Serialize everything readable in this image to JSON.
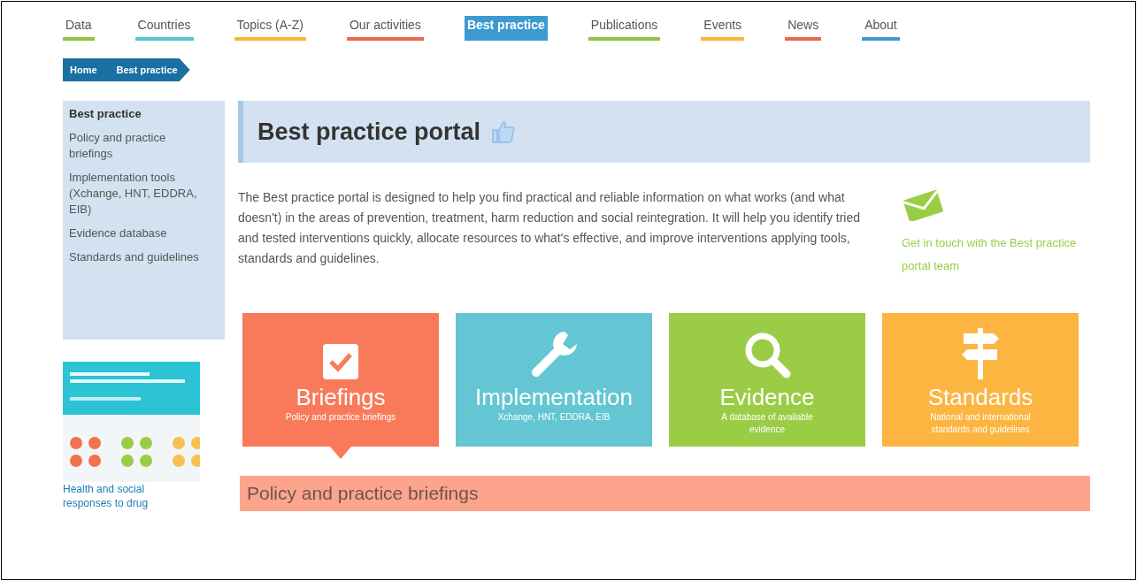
{
  "nav": [
    {
      "label": "Data",
      "color": "#8cc63f",
      "selected": false
    },
    {
      "label": "Countries",
      "color": "#5bc5d0",
      "selected": false
    },
    {
      "label": "Topics (A-Z)",
      "color": "#f7b733",
      "selected": false
    },
    {
      "label": "Our activities",
      "color": "#e8694a",
      "selected": false
    },
    {
      "label": "Best practice",
      "color": "#3d9ad1",
      "selected": true
    },
    {
      "label": "Publications",
      "color": "#8cc63f",
      "selected": false
    },
    {
      "label": "Events",
      "color": "#f7b733",
      "selected": false
    },
    {
      "label": "News",
      "color": "#e8694a",
      "selected": false
    },
    {
      "label": "About",
      "color": "#3d9ad1",
      "selected": false
    }
  ],
  "breadcrumb": [
    "Home",
    "Best practice"
  ],
  "sidebar": {
    "items": [
      {
        "label": "Best practice",
        "selected": true
      },
      {
        "label": "Policy and practice briefings",
        "selected": false
      },
      {
        "label": "Implementation tools (Xchange, HNT, EDDRA, EIB)",
        "selected": false
      },
      {
        "label": "Evidence database",
        "selected": false
      },
      {
        "label": "Standards and guidelines",
        "selected": false
      }
    ],
    "promo": {
      "kind": "picture",
      "link": "Health and social responses to drug"
    }
  },
  "page": {
    "title": "Best practice portal",
    "intro": "The Best practice portal is designed to help you find practical and reliable information on what works (and what doesn't) in the areas of prevention, treatment, harm reduction and social reintegration. It will help you identify tried and tested interventions quickly, allocate resources to what's effective, and improve interventions applying tools, standards and guidelines.",
    "contact": "Get in touch with the Best practice portal team",
    "tiles": [
      {
        "kind": "check",
        "title": "Briefings",
        "subtitle": "Policy and practice briefings",
        "color": "#f87a5a",
        "selected": true
      },
      {
        "kind": "wrench",
        "title": "Implementation",
        "subtitle": "Xchange, HNT, EDDRA, EIB",
        "color": "#64c6d2",
        "selected": false
      },
      {
        "kind": "search",
        "title": "Evidence",
        "subtitle": "A database of available evidence",
        "color": "#9acd45",
        "selected": false
      },
      {
        "kind": "signpost",
        "title": "Standards",
        "subtitle": "National and international standards and guidelines",
        "color": "#fbb540",
        "selected": false
      }
    ],
    "section_title": "Policy and practice briefings"
  }
}
